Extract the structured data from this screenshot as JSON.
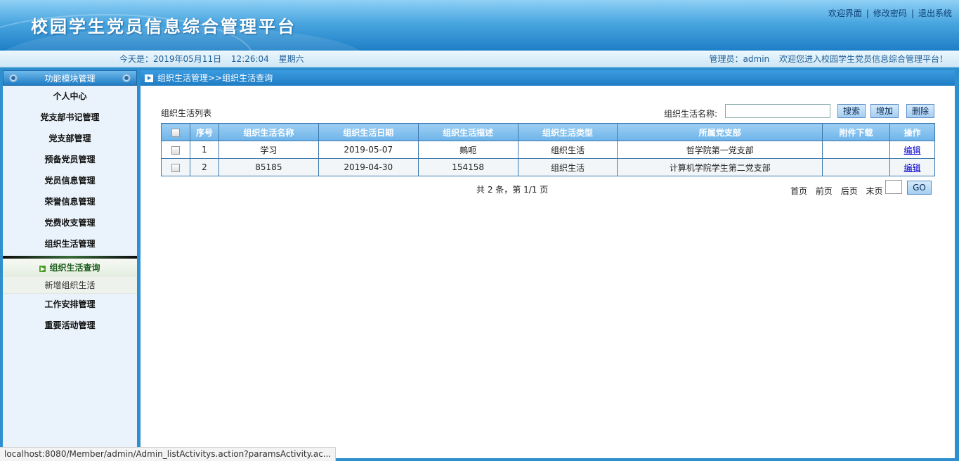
{
  "header": {
    "title": "校园学生党员信息综合管理平台",
    "links": [
      "欢迎界面",
      "修改密码",
      "退出系统"
    ],
    "separator": "|"
  },
  "infobar": {
    "today_label": "今天是：2019年05月11日",
    "time": "12:26:04",
    "weekday": "星期六",
    "admin": "管理员：admin",
    "welcome": "欢迎您进入校园学生党员信息综合管理平台！"
  },
  "sidebar": {
    "title": "功能模块管理",
    "items": [
      "个人中心",
      "党支部书记管理",
      "党支部管理",
      "预备党员管理",
      "党员信息管理",
      "荣誉信息管理",
      "党费收支管理",
      "组织生活管理"
    ],
    "submenu": [
      "组织生活查询",
      "新增组织生活"
    ],
    "items_after": [
      "工作安排管理",
      "重要活动管理"
    ]
  },
  "main": {
    "breadcrumb": "组织生活管理>>组织生活查询",
    "list_title": "组织生活列表",
    "search_label": "组织生活名称:",
    "search_value": "",
    "buttons": {
      "search": "搜索",
      "add": "增加",
      "delete": "删除",
      "go": "GO"
    },
    "columns": [
      "序号",
      "组织生活名称",
      "组织生活日期",
      "组织生活描述",
      "组织生活类型",
      "所属党支部",
      "附件下载",
      "操作"
    ],
    "rows": [
      {
        "no": "1",
        "name": "学习",
        "date": "2019-05-07",
        "desc": "鷞呃",
        "type": "组织生活",
        "branch": "哲学院第一党支部",
        "file": "",
        "action": "编辑"
      },
      {
        "no": "2",
        "name": "85185",
        "date": "2019-04-30",
        "desc": "154158",
        "type": "组织生活",
        "branch": "计算机学院学生第二党支部",
        "file": "",
        "action": "编辑"
      }
    ],
    "page_info": "共 2 条，第 1/1 页",
    "pager": [
      "首页",
      "前页",
      "后页",
      "末页"
    ],
    "page_input": ""
  },
  "statusbar": "localhost:8080/Member/admin/Admin_listActivitys.action?paramsActivity.ac..."
}
